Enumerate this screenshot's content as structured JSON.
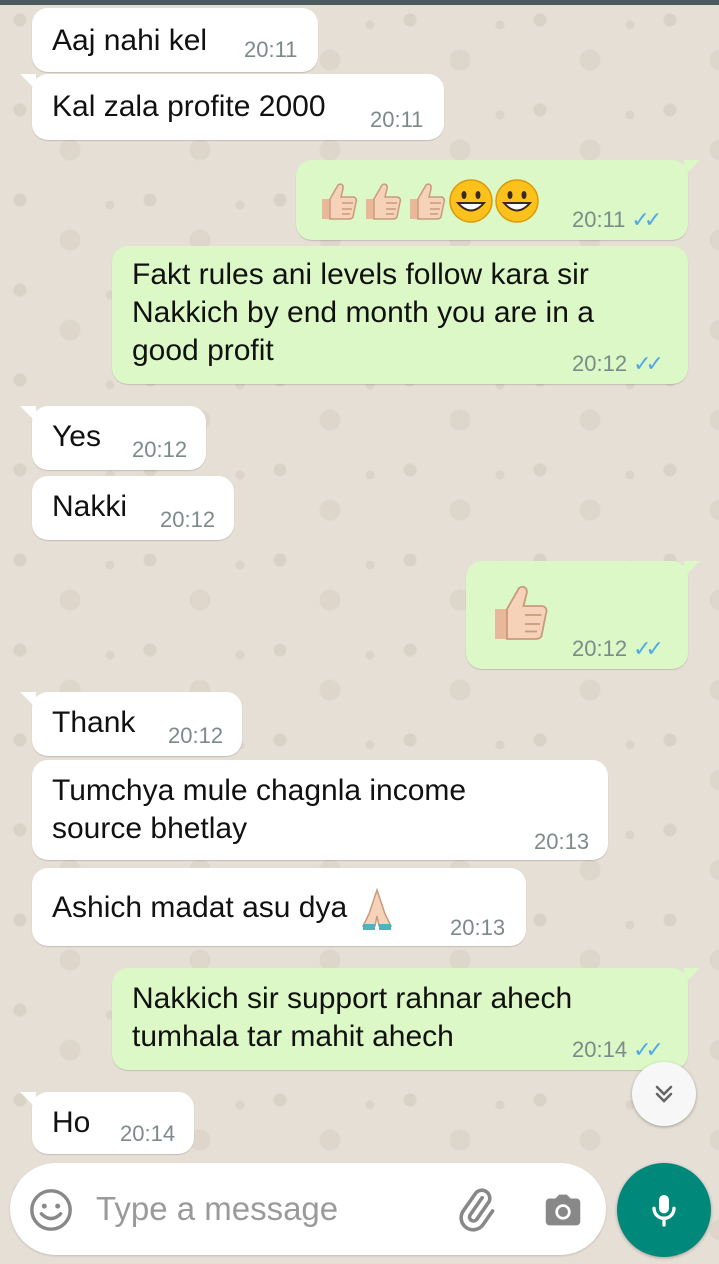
{
  "messages": [
    {
      "text": "Aaj nahi kel",
      "time": "20:11",
      "dir": "in"
    },
    {
      "text": "Kal zala profite 2000",
      "time": "20:11",
      "dir": "in"
    },
    {
      "emoji": "👍👍👍😀😀",
      "time": "20:11",
      "dir": "out",
      "status": "read"
    },
    {
      "text": "Fakt rules ani levels follow kara sir\nNakkich by end month you are in a\ngood profit",
      "time": "20:12",
      "dir": "out",
      "status": "read"
    },
    {
      "text": "Yes",
      "time": "20:12",
      "dir": "in"
    },
    {
      "text": "Nakki",
      "time": "20:12",
      "dir": "in"
    },
    {
      "emoji": "👍",
      "time": "20:12",
      "dir": "out",
      "status": "read"
    },
    {
      "text": "Thank",
      "time": "20:12",
      "dir": "in"
    },
    {
      "text": "Tumchya mule chagnla income\nsource bhetlay",
      "time": "20:13",
      "dir": "in"
    },
    {
      "text": "Ashich madat asu dya",
      "emoji": "🙏",
      "time": "20:13",
      "dir": "in"
    },
    {
      "text": "Nakkich sir support rahnar ahech\ntumhala tar mahit ahech",
      "time": "20:14",
      "dir": "out",
      "status": "read"
    },
    {
      "text": "Ho",
      "time": "20:14",
      "dir": "in"
    }
  ],
  "composer": {
    "placeholder": "Type a message",
    "emoji_icon": "smiley-icon",
    "attach_icon": "paperclip-icon",
    "camera_icon": "camera-icon",
    "mic_icon": "microphone-icon"
  },
  "scroll_down_icon": "double-chevron-down-icon",
  "colors": {
    "incoming_bubble": "#ffffff",
    "outgoing_bubble": "#dcf8c6",
    "read_ticks": "#4fa8e8",
    "mic_button": "#00897b",
    "wallpaper": "#e6dfd6"
  }
}
